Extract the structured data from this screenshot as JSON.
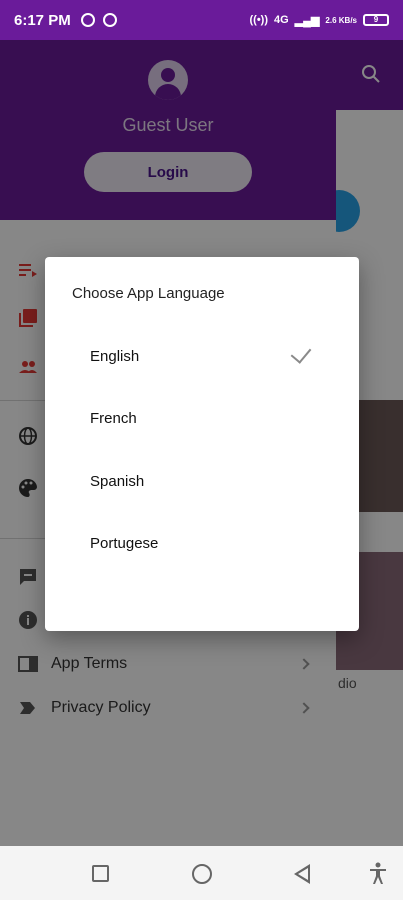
{
  "status_bar": {
    "time": "6:17 PM",
    "network": "4G",
    "data_speed": "2.6 KB/s",
    "battery_level": "9"
  },
  "drawer": {
    "user_name": "Guest User",
    "login_label": "Login",
    "items": [
      {
        "icon": "playlist-icon",
        "label": ""
      },
      {
        "icon": "library-icon",
        "label": ""
      },
      {
        "icon": "people-icon",
        "label": ""
      },
      {
        "icon": "globe-icon",
        "label": ""
      },
      {
        "icon": "palette-icon",
        "label": ""
      },
      {
        "icon": "feedback-icon",
        "label": ""
      },
      {
        "icon": "info-icon",
        "label": ""
      },
      {
        "icon": "document-icon",
        "label": "App Terms"
      },
      {
        "icon": "label-icon",
        "label": "Privacy Policy"
      }
    ]
  },
  "background": {
    "partial_text": "dio"
  },
  "dialog": {
    "title": "Choose App Language",
    "options": [
      {
        "label": "English",
        "selected": true
      },
      {
        "label": "French",
        "selected": false
      },
      {
        "label": "Spanish",
        "selected": false
      },
      {
        "label": "Portugese",
        "selected": false
      }
    ]
  },
  "colors": {
    "primary": "#6a1b9a",
    "accent_icon": "#e53935"
  }
}
